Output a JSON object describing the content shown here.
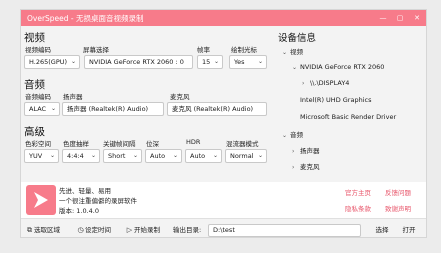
{
  "window": {
    "title": "OverSpeed - 无损桌面音视频录制",
    "controls": [
      "—",
      "▢",
      "✕"
    ]
  },
  "video": {
    "section": "视频",
    "labels": {
      "codec": "视频编码",
      "screen": "屏幕选择",
      "fps": "帧率",
      "cursor": "绘制光标"
    },
    "values": {
      "codec": "H.265(GPU)",
      "screen": "NVIDIA GeForce RTX 2060 : 0",
      "fps": "15",
      "cursor": "Yes"
    }
  },
  "audio": {
    "section": "音频",
    "labels": {
      "codec": "音频编码",
      "speaker": "扬声器",
      "mic": "麦克风"
    },
    "values": {
      "codec": "ALAC",
      "speaker": "扬声器 (Realtek(R) Audio)",
      "mic": "麦克风 (Realtek(R) Audio)"
    }
  },
  "advanced": {
    "section": "高级",
    "labels": {
      "colorspace": "色彩空间",
      "chroma": "色度抽样",
      "keyframe": "关键帧间隔",
      "bitdepth": "位深",
      "hdr": "HDR",
      "mixer": "混流器模式"
    },
    "values": {
      "colorspace": "YUV",
      "chroma": "4:4:4",
      "keyframe": "Short",
      "bitdepth": "Auto",
      "hdr": "Auto",
      "mixer": "Normal"
    }
  },
  "device_info": {
    "title": "设备信息",
    "video": "视频",
    "gpu": "NVIDIA GeForce RTX 2060",
    "display": "\\\\.\\DISPLAY4",
    "intel": "Intel(R) UHD Graphics",
    "msbasic": "Microsoft Basic Render Driver",
    "audio": "音频",
    "speaker": "扬声器",
    "mic": "麦克风"
  },
  "about": {
    "slogan": "先进、轻量、易用",
    "desc": "一个很注重偏僻的录屏软件",
    "version": "版本: 1.0.4.0",
    "links": {
      "home": "官方主页",
      "feedback": "反馈问题",
      "privacy": "隐私条款",
      "thanks": "致谢声明"
    }
  },
  "toolbar": {
    "select_area": "选取区域",
    "set_time": "设定时间",
    "start": "开始录制",
    "output_label": "输出目录:",
    "output_path": "D:\\test",
    "choose": "选择",
    "open": "打开"
  },
  "colors": {
    "accent": "#f77b8a",
    "link": "#e8556a"
  }
}
